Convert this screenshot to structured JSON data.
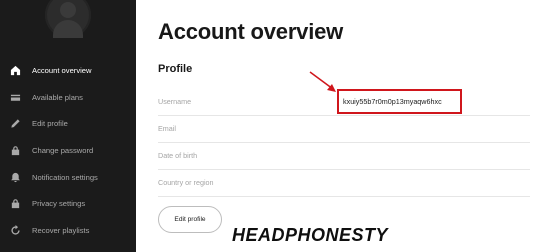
{
  "sidebar": {
    "items": [
      {
        "label": "Account overview",
        "icon": "home-icon",
        "active": true
      },
      {
        "label": "Available plans",
        "icon": "card-icon",
        "active": false
      },
      {
        "label": "Edit profile",
        "icon": "pencil-icon",
        "active": false
      },
      {
        "label": "Change password",
        "icon": "lock-icon",
        "active": false
      },
      {
        "label": "Notification settings",
        "icon": "bell-icon",
        "active": false
      },
      {
        "label": "Privacy settings",
        "icon": "lock-icon",
        "active": false
      },
      {
        "label": "Recover playlists",
        "icon": "refresh-icon",
        "active": false
      }
    ]
  },
  "main": {
    "title": "Account overview",
    "section_title": "Profile",
    "fields": [
      {
        "label": "Username",
        "value": "kxuiy55b7r0m0p13myaqw6hxc"
      },
      {
        "label": "Email",
        "value": ""
      },
      {
        "label": "Date of birth",
        "value": ""
      },
      {
        "label": "Country or region",
        "value": ""
      }
    ],
    "edit_button_label": "Edit profile"
  },
  "watermark": "HEADPHONESTY",
  "colors": {
    "sidebar_bg": "#1b1b1b",
    "highlight": "#d0161c"
  }
}
